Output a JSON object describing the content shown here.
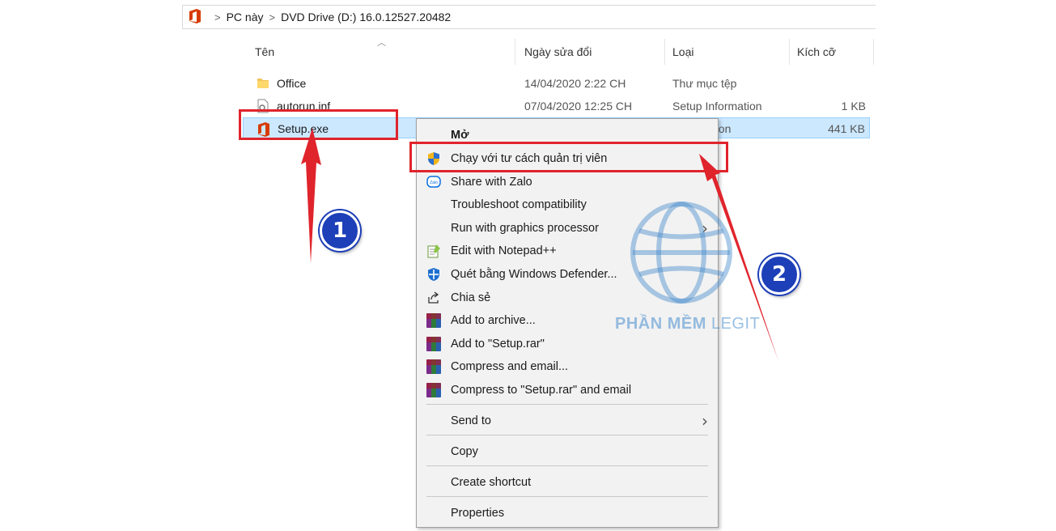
{
  "breadcrumb": {
    "items": [
      "PC này",
      "DVD Drive (D:) 16.0.12527.20482"
    ],
    "separator": ">"
  },
  "columns": {
    "name": "Tên",
    "date": "Ngày sửa đổi",
    "type": "Loại",
    "size": "Kích cỡ"
  },
  "files": [
    {
      "name": "Office",
      "date": "14/04/2020 2:22 CH",
      "type": "Thư mục tệp",
      "size": "",
      "icon": "folder-icon"
    },
    {
      "name": "autorun.inf",
      "date": "07/04/2020 12:25 CH",
      "type": "Setup Information",
      "size": "1 KB",
      "icon": "setup-info-file-icon"
    },
    {
      "name": "Setup.exe",
      "date": "",
      "type": "ation",
      "size": "441 KB",
      "icon": "office-logo-icon"
    }
  ],
  "context_menu": {
    "open": "Mở",
    "run_as_admin": "Chạy với tư cách quản trị viên",
    "share_zalo": "Share with Zalo",
    "troubleshoot": "Troubleshoot compatibility",
    "run_gpu": "Run with graphics processor",
    "edit_npp": "Edit with Notepad++",
    "scan_defender": "Quét bằng Windows Defender...",
    "share": "Chia sẻ",
    "add_archive": "Add to archive...",
    "add_rar": "Add to \"Setup.rar\"",
    "compress_email": "Compress and email...",
    "compress_rar_email": "Compress to \"Setup.rar\" and email",
    "send_to": "Send to",
    "copy": "Copy",
    "create_shortcut": "Create shortcut",
    "properties": "Properties"
  },
  "annotations": {
    "step1": "1",
    "step2": "2"
  },
  "watermark": {
    "bold": "PHẦN MỀM",
    "light": "LEGIT"
  },
  "colors": {
    "highlight": "#e0242c",
    "badge": "#1d3fb8",
    "selection": "#cce8ff",
    "office_orange": "#d83b01"
  }
}
